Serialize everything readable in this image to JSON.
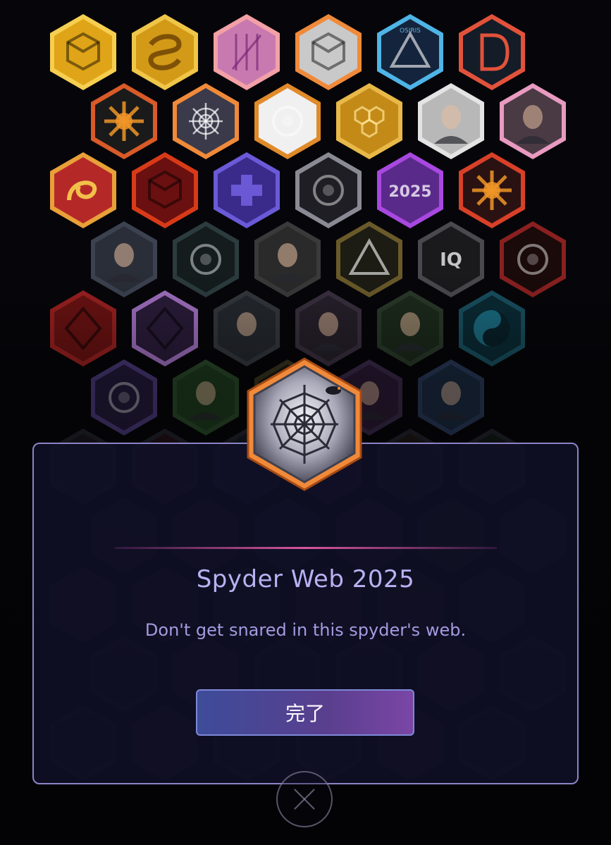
{
  "dialog": {
    "title": "Spyder Web 2025",
    "description": "Don't get snared in this spyder's web.",
    "done_label": "完了"
  },
  "badges": [
    {
      "name": "badge-gold-cube",
      "fill": "#e0a418",
      "rim": "#f6cf50",
      "glyph": "cube"
    },
    {
      "name": "badge-gold-knot",
      "fill": "#d39a18",
      "rim": "#f0c648",
      "glyph": "knot"
    },
    {
      "name": "badge-pink-grid",
      "fill": "#c87ab0",
      "rim": "#f3a0a6",
      "glyph": "grid"
    },
    {
      "name": "badge-red-cube",
      "fill": "#c9c9c9",
      "rim": "#f08a3a",
      "glyph": "cube"
    },
    {
      "name": "badge-osiris",
      "fill": "#14243c",
      "rim": "#4fb4e6",
      "glyph": "triangle",
      "text": "OSIRIS"
    },
    {
      "name": "badge-d-logo",
      "fill": "#141c28",
      "rim": "#e2523a",
      "glyph": "d"
    },
    {
      "name": "badge-sunburst",
      "fill": "#1a1a1a",
      "rim": "#d85a28",
      "glyph": "sun"
    },
    {
      "name": "badge-spyder-web",
      "fill": "#3a3a4a",
      "rim": "#f08a3a",
      "glyph": "web"
    },
    {
      "name": "badge-planet-gun",
      "fill": "#f0f0f0",
      "rim": "#e08a2a",
      "glyph": "ring"
    },
    {
      "name": "badge-gold-honeycomb",
      "fill": "#c48a18",
      "rim": "#e8b848",
      "glyph": "honey"
    },
    {
      "name": "badge-portrait-man",
      "fill": "#b8b8b8",
      "rim": "#e4e4e4",
      "glyph": "face"
    },
    {
      "name": "badge-portrait-woman",
      "fill": "#4a3a44",
      "rim": "#e89ac0",
      "glyph": "face"
    },
    {
      "name": "badge-snake",
      "fill": "#b52828",
      "rim": "#e8a038",
      "glyph": "snake"
    },
    {
      "name": "badge-red-box",
      "fill": "#6a1010",
      "rim": "#d83a18",
      "glyph": "cube"
    },
    {
      "name": "badge-purple-cross",
      "fill": "#3a2a8a",
      "rim": "#6a5ad8",
      "glyph": "cross"
    },
    {
      "name": "badge-circuit",
      "fill": "#1e1e24",
      "rim": "#8a8a94",
      "glyph": "ring"
    },
    {
      "name": "badge-2025",
      "fill": "#5a2a8a",
      "rim": "#a848e0",
      "glyph": "text",
      "text": "2025"
    },
    {
      "name": "badge-red-splash",
      "fill": "#2a1212",
      "rim": "#d84028",
      "glyph": "sun"
    },
    {
      "name": "badge-blonde-agent",
      "fill": "#2a2e38",
      "rim": "#3c4250",
      "glyph": "face"
    },
    {
      "name": "badge-teal-dodecahedron",
      "fill": "#141c1e",
      "rim": "#2c3c3e",
      "glyph": "ring"
    },
    {
      "name": "badge-bearded-agent",
      "fill": "#2a2a2a",
      "rim": "#3a3a3a",
      "glyph": "face"
    },
    {
      "name": "badge-gold-emblem",
      "fill": "#1c1c14",
      "rim": "#6a5a2a",
      "glyph": "triangle"
    },
    {
      "name": "badge-iq",
      "fill": "#1a1a1c",
      "rim": "#4a4a4e",
      "glyph": "text",
      "text": "IQ"
    },
    {
      "name": "badge-red-circle-h",
      "fill": "#1a0a0a",
      "rim": "#8a2020",
      "glyph": "ring"
    },
    {
      "name": "badge-red-diamond",
      "fill": "#6a1212",
      "rim": "#9a2020",
      "glyph": "diamond"
    },
    {
      "name": "badge-purple-chevron",
      "fill": "#2a1c3a",
      "rim": "#a070c0",
      "glyph": "diamond"
    },
    {
      "name": "badge-dark-hair-agent",
      "fill": "#24282e",
      "rim": "#34383e",
      "glyph": "face"
    },
    {
      "name": "badge-blue-hair-agent",
      "fill": "#26202a",
      "rim": "#3a3040",
      "glyph": "face"
    },
    {
      "name": "badge-masked-agent",
      "fill": "#1c2a1c",
      "rim": "#2a3a2a",
      "glyph": "face"
    },
    {
      "name": "badge-yin-yang",
      "fill": "#0a2a34",
      "rim": "#185060",
      "glyph": "yinyang"
    },
    {
      "name": "badge-purple-vortex",
      "fill": "#221a3a",
      "rim": "#4a3a7a",
      "glyph": "ring"
    },
    {
      "name": "badge-suited-agent",
      "fill": "#1e3a1e",
      "rim": "#2a4a2a",
      "glyph": "face"
    },
    {
      "name": "badge-pyramid-eye",
      "fill": "#1c1a12",
      "rim": "#3a3420",
      "glyph": "triangle"
    },
    {
      "name": "badge-curly-agent",
      "fill": "#2a1a34",
      "rim": "#3a2a4a",
      "glyph": "face"
    },
    {
      "name": "badge-blonde-suit-agent",
      "fill": "#1a2a40",
      "rim": "#2a3a5a",
      "glyph": "face"
    }
  ],
  "hidden_badges_rows": 5
}
